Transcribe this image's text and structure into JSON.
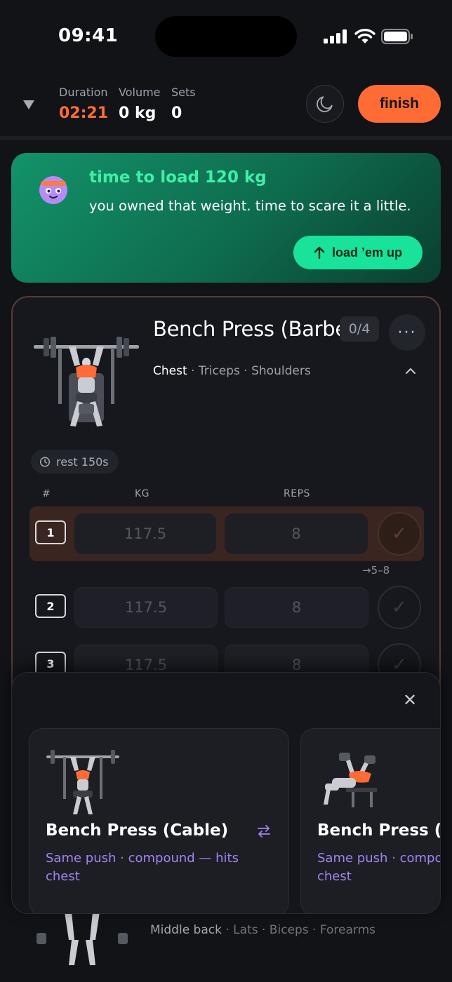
{
  "status": {
    "time": "09:41"
  },
  "header": {
    "stats": [
      {
        "label": "Duration",
        "value": "02:21"
      },
      {
        "label": "Volume",
        "value": "0 kg"
      },
      {
        "label": "Sets",
        "value": "0"
      }
    ],
    "finish_label": "finish"
  },
  "banner": {
    "title": "time to load 120 kg",
    "text": "you owned that weight. time to scare it a little.",
    "button_label": "load ’em up"
  },
  "exercise": {
    "title": "Bench Press (Barbell)",
    "count": "0/4",
    "muscles": {
      "primary": "Chest",
      "secondary": " · Triceps · Shoulders"
    },
    "rest": "rest 150s",
    "columns": {
      "set": "#",
      "kg": "KG",
      "reps": "REPS"
    },
    "sets": [
      {
        "no": "1",
        "kg": "117.5",
        "reps": "8"
      },
      {
        "no": "2",
        "kg": "117.5",
        "reps": "8"
      },
      {
        "no": "3",
        "kg": "117.5",
        "reps": "8"
      }
    ],
    "target": "→5–8",
    "check_glyph": "✓"
  },
  "next_exercise_peek": {
    "muscles_primary": "Middle back",
    "muscles_secondary": " · Lats · Biceps · Forearms"
  },
  "sheet": {
    "close_glyph": "✕",
    "alternatives": [
      {
        "name": "Bench Press (Cable)",
        "description": "Same push · compound — hits chest"
      },
      {
        "name": "Bench Press (Dumbbell)",
        "description": "Same push · compound — hits chest"
      }
    ]
  },
  "colors": {
    "accent": "#ff6b35",
    "success": "#19e39a",
    "purple": "#a283f0"
  }
}
